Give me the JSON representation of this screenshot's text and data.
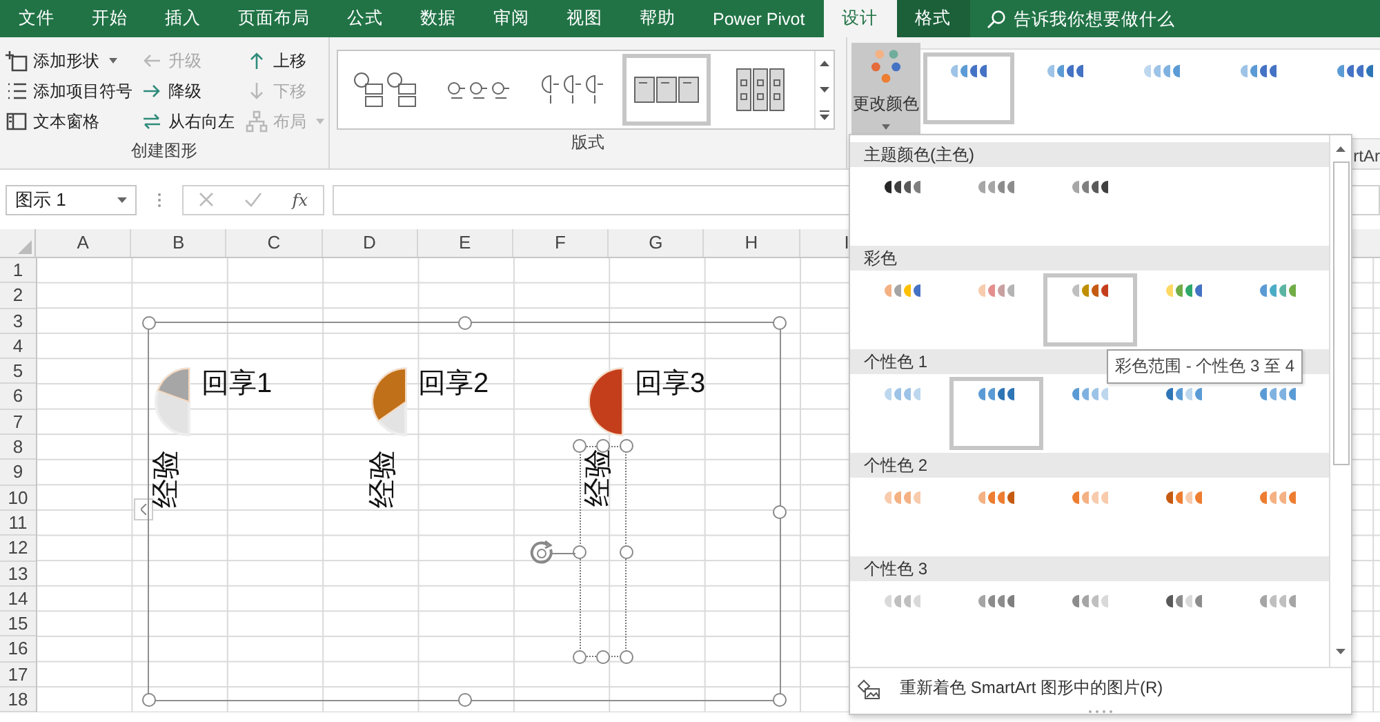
{
  "ribbon_tabs": [
    {
      "label": "文件",
      "kind": "tab",
      "selected": false
    },
    {
      "label": "开始",
      "kind": "tab",
      "selected": false
    },
    {
      "label": "插入",
      "kind": "tab",
      "selected": false
    },
    {
      "label": "页面布局",
      "kind": "tab",
      "selected": false
    },
    {
      "label": "公式",
      "kind": "tab",
      "selected": false
    },
    {
      "label": "数据",
      "kind": "tab",
      "selected": false
    },
    {
      "label": "审阅",
      "kind": "tab",
      "selected": false
    },
    {
      "label": "视图",
      "kind": "tab",
      "selected": false
    },
    {
      "label": "帮助",
      "kind": "tab",
      "selected": false
    },
    {
      "label": "Power Pivot",
      "kind": "tab",
      "selected": false
    },
    {
      "label": "设计",
      "kind": "tab",
      "selected": true
    },
    {
      "label": "格式",
      "kind": "contextual",
      "selected": false
    }
  ],
  "search": {
    "placeholder": "告诉我你想要做什么"
  },
  "create_graphic_group": {
    "label": "创建图形",
    "commands": [
      {
        "label": "添加形状",
        "disabled": false,
        "has_menu": true
      },
      {
        "label": "升级",
        "disabled": true,
        "has_menu": false
      },
      {
        "label": "上移",
        "disabled": false,
        "has_menu": false
      },
      {
        "label": "添加项目符号",
        "disabled": false,
        "has_menu": false
      },
      {
        "label": "降级",
        "disabled": false,
        "has_menu": false
      },
      {
        "label": "下移",
        "disabled": true,
        "has_menu": false
      },
      {
        "label": "文本窗格",
        "disabled": false,
        "has_menu": false
      },
      {
        "label": "从右向左",
        "disabled": false,
        "has_menu": false
      },
      {
        "label": "布局",
        "disabled": true,
        "has_menu": true
      }
    ]
  },
  "layouts_group": {
    "label": "版式",
    "layouts": [
      {
        "selected": false
      },
      {
        "selected": false
      },
      {
        "selected": false
      },
      {
        "selected": true
      },
      {
        "selected": false
      }
    ]
  },
  "change_colors_button": {
    "label": "更改颜色",
    "expanded": true
  },
  "styles_gallery": {
    "label": "rtAr",
    "styles": [
      {
        "selected": true
      },
      {
        "selected": false
      },
      {
        "selected": false
      },
      {
        "selected": false
      },
      {
        "selected": false
      }
    ]
  },
  "name_box": {
    "value": "图示 1"
  },
  "formula_bar": {
    "fx_label": "fx"
  },
  "columns": [
    "A",
    "B",
    "C",
    "D",
    "E",
    "F",
    "G",
    "H",
    "I"
  ],
  "rows": [
    "1",
    "2",
    "3",
    "4",
    "5",
    "6",
    "7",
    "8",
    "9",
    "10",
    "11",
    "12",
    "13",
    "14",
    "15",
    "16",
    "17",
    "18"
  ],
  "smartart": {
    "items": [
      {
        "title": "回享1",
        "text": "经验",
        "color": "#a6a6a6",
        "selected": false
      },
      {
        "title": "回享2",
        "text": "经验",
        "color": "#c07018",
        "selected": false
      },
      {
        "title": "回享3",
        "text": "经验",
        "color": "#c43e1c",
        "selected": true
      }
    ]
  },
  "color_menu": {
    "sections": [
      {
        "title": "主题颜色(主色)",
        "options": [
          {
            "highlighted": false
          },
          {
            "highlighted": false
          },
          {
            "highlighted": false
          }
        ]
      },
      {
        "title": "彩色",
        "options": [
          {
            "highlighted": false
          },
          {
            "highlighted": false
          },
          {
            "highlighted": true
          },
          {
            "highlighted": false
          },
          {
            "highlighted": false
          }
        ]
      },
      {
        "title": "个性色 1",
        "options": [
          {
            "highlighted": false
          },
          {
            "highlighted": true
          },
          {
            "highlighted": false
          },
          {
            "highlighted": false
          },
          {
            "highlighted": false
          }
        ]
      },
      {
        "title": "个性色 2",
        "options": [
          {
            "highlighted": false
          },
          {
            "highlighted": false
          },
          {
            "highlighted": false
          },
          {
            "highlighted": false
          },
          {
            "highlighted": false
          }
        ]
      },
      {
        "title": "个性色 3",
        "options": [
          {
            "highlighted": false
          },
          {
            "highlighted": false
          },
          {
            "highlighted": false
          },
          {
            "highlighted": false
          },
          {
            "highlighted": false
          }
        ]
      }
    ],
    "tooltip": "彩色范围 - 个性色 3 至 4",
    "footer": "重新着色 SmartArt 图形中的图片(R)"
  }
}
